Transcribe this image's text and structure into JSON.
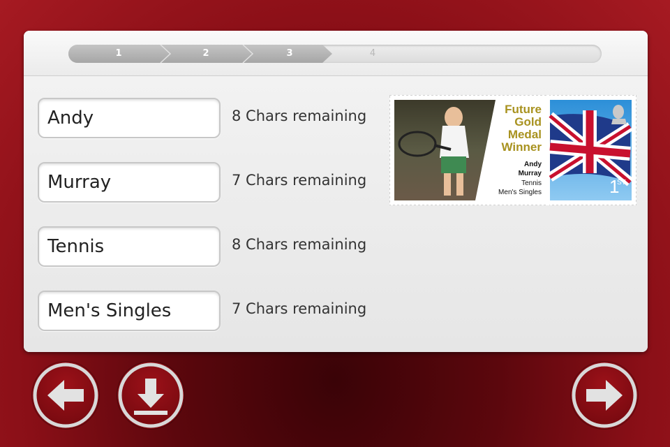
{
  "progress": {
    "steps": [
      "1",
      "2",
      "3",
      "4"
    ],
    "current_step": 3
  },
  "fields": [
    {
      "value": "Andy",
      "remaining": "8 Chars remaining"
    },
    {
      "value": "Murray",
      "remaining": "7 Chars remaining"
    },
    {
      "value": "Tennis",
      "remaining": "8 Chars remaining"
    },
    {
      "value": "Men's Singles",
      "remaining": "7 Chars remaining"
    }
  ],
  "stamp": {
    "headline": [
      "Future",
      "Gold",
      "Medal",
      "Winner"
    ],
    "name_line1": "Andy",
    "name_line2": "Murray",
    "sport": "Tennis",
    "event": "Men's Singles",
    "value_digit": "1",
    "value_suffix": "ST"
  },
  "buttons": {
    "back": "back-arrow-icon",
    "download": "download-icon",
    "next": "forward-arrow-icon"
  },
  "colors": {
    "headline_gold": "#a8921f",
    "background_red": "#8a0f17",
    "active_step": "#b0b0b0"
  }
}
